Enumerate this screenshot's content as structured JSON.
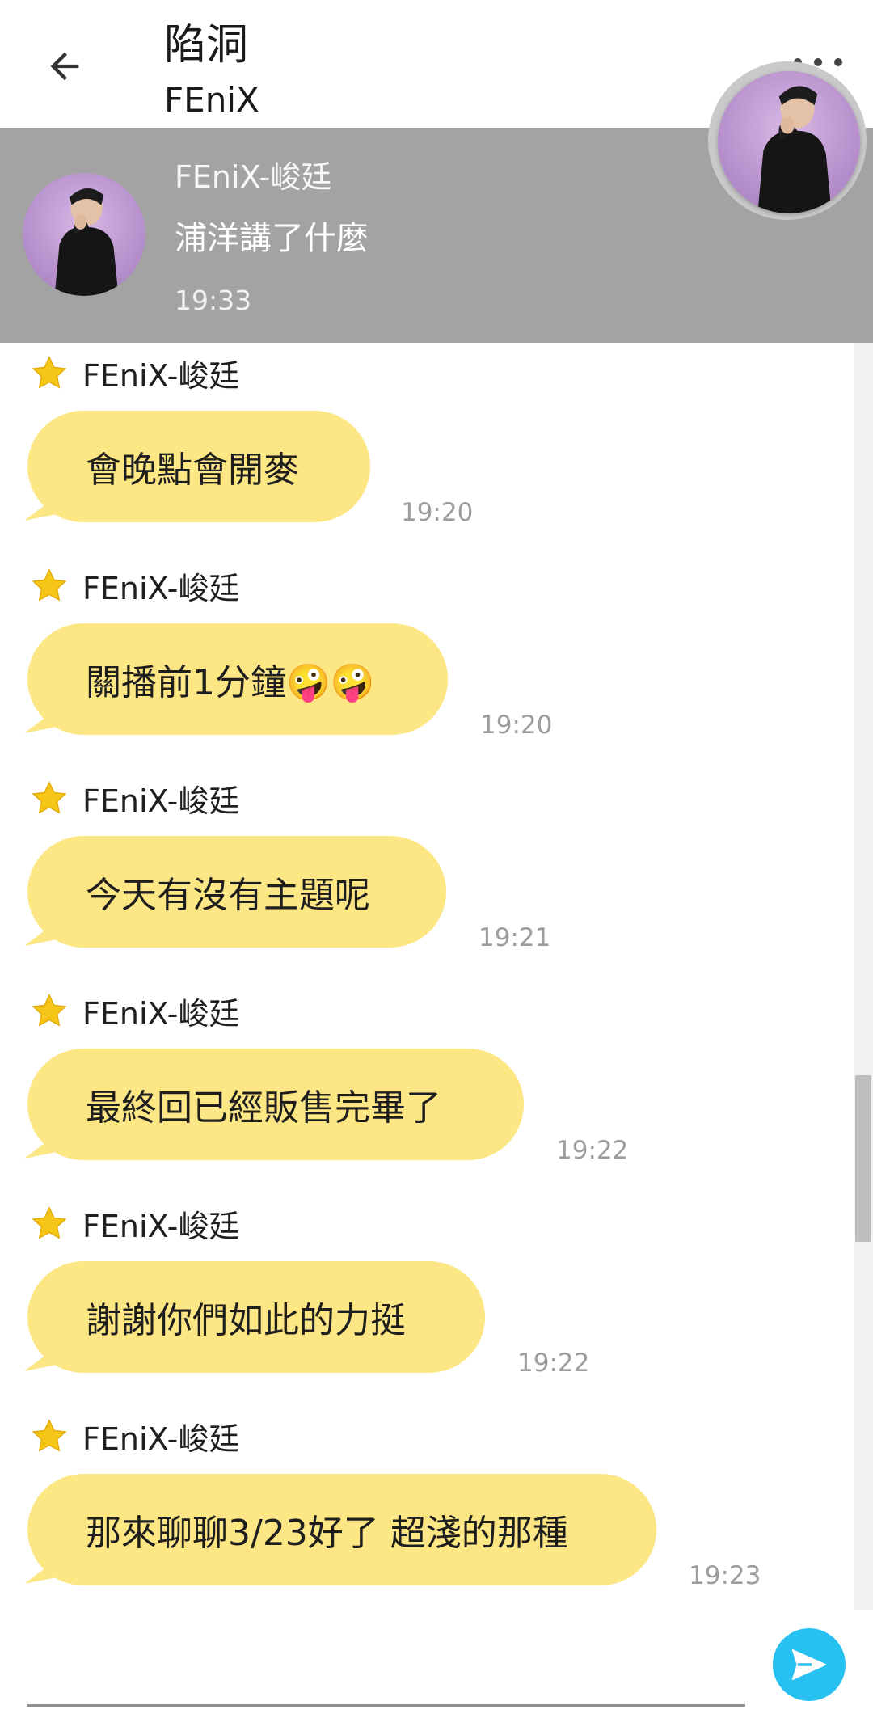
{
  "header": {
    "title": "陷洞",
    "subtitle": "FEniX"
  },
  "pinned": {
    "name": "FEniX-峻廷",
    "message": "浦洋講了什麼",
    "time": "19:33"
  },
  "messages": [
    {
      "sender": "FEniX-峻廷",
      "text": "會晚點會開麥",
      "time": "19:20"
    },
    {
      "sender": "FEniX-峻廷",
      "text": "關播前1分鐘🤪🤪",
      "time": "19:20"
    },
    {
      "sender": "FEniX-峻廷",
      "text": "今天有沒有主題呢",
      "time": "19:21"
    },
    {
      "sender": "FEniX-峻廷",
      "text": "最終回已經販售完畢了",
      "time": "19:22"
    },
    {
      "sender": "FEniX-峻廷",
      "text": "謝謝你們如此的力挺",
      "time": "19:22"
    },
    {
      "sender": "FEniX-峻廷",
      "text": "那來聊聊3/23好了 超淺的那種",
      "time": "19:23"
    }
  ],
  "colors": {
    "bubble": "#fde684",
    "banner": "#a3a3a3",
    "send": "#27c1f1",
    "star": "#f5c518"
  },
  "icons": {
    "back": "arrow-left-icon",
    "more": "more-vertical-icon",
    "star": "star-icon",
    "send": "send-icon"
  }
}
